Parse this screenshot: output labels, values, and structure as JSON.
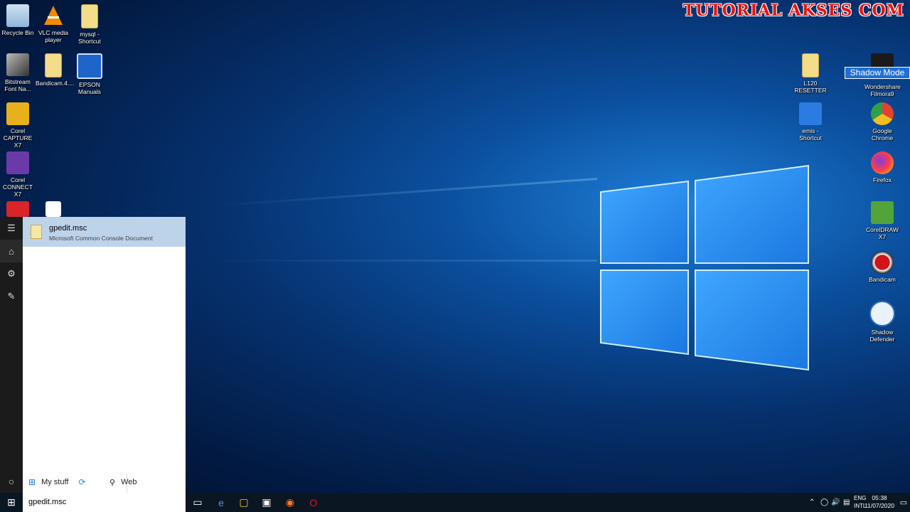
{
  "watermark": "TUTORIAL AKSES COM",
  "tooltip": "Shadow Mode",
  "desktop_icons_left": [
    {
      "label": "Recycle Bin",
      "icon": "recycle-bin-icon",
      "color": "#8fb6d9"
    },
    {
      "label": "VLC media player",
      "icon": "vlc-icon",
      "color": "#f08a00"
    },
    {
      "label": "mysql - Shortcut",
      "icon": "folder-icon",
      "color": "#f3dc8a"
    },
    {
      "label": "Bitstream Font Na...",
      "icon": "bitstream-icon",
      "color": "#4a4a4a"
    },
    {
      "label": "Bandicam.4....",
      "icon": "bandicam-file-icon",
      "color": "#f3dc8a"
    },
    {
      "label": "EPSON Manuals",
      "icon": "epson-icon",
      "color": "#1f64c8"
    },
    {
      "label": "Corel CAPTURE X7",
      "icon": "corel-capture-icon",
      "color": "#e7b11d"
    },
    {
      "label": "Corel CONNECT X7",
      "icon": "corel-connect-icon",
      "color": "#6a3aa8"
    }
  ],
  "desktop_icons_right": [
    {
      "label": "L120 RESETTER",
      "icon": "folder-icon",
      "color": "#f3dc8a"
    },
    {
      "label": "Wondershare Filmora9",
      "icon": "filmora-icon",
      "color": "#1a1a1a"
    },
    {
      "label": "emis - Shortcut",
      "icon": "emis-icon",
      "color": "#2b7be0"
    },
    {
      "label": "Google Chrome",
      "icon": "chrome-icon",
      "color": "#e34133"
    },
    {
      "label": "Firefox",
      "icon": "firefox-icon",
      "color": "#ff7a1f"
    },
    {
      "label": "CorelDRAW X7",
      "icon": "coreldraw-icon",
      "color": "#52a43a"
    },
    {
      "label": "Bandicam",
      "icon": "bandicam-icon",
      "color": "#d0141a"
    },
    {
      "label": "Shadow Defender",
      "icon": "shadow-defender-icon",
      "color": "#2f6ec2"
    }
  ],
  "search_panel": {
    "result_name": "gpedit.msc",
    "result_type": "Microsoft Common Console Document",
    "scope_mystuff": "My stuff",
    "scope_web": "Web",
    "query": "gpedit.msc"
  },
  "taskbar": {
    "lang_line1": "ENG",
    "lang_line2": "INTL",
    "time": "05:38",
    "date": "11/07/2020"
  }
}
